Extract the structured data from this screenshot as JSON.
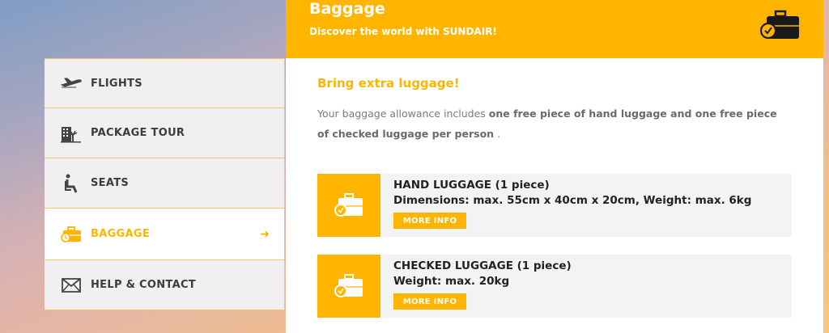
{
  "header": {
    "title": "Baggage",
    "subtitle": "Discover the world with SUNDAIR!",
    "icon": "suitcase-clock-icon",
    "color": "#ffb400"
  },
  "sidebar": {
    "items": [
      {
        "label": "FLIGHTS",
        "icon": "airplane-icon"
      },
      {
        "label": "PACKAGE TOUR",
        "icon": "hotel-palm-icon"
      },
      {
        "label": "SEATS",
        "icon": "seat-icon"
      },
      {
        "label": "BAGGAGE",
        "icon": "suitcase-icon",
        "active": true,
        "arrow": "➜"
      },
      {
        "label": "HELP & CONTACT",
        "icon": "envelope-icon"
      }
    ]
  },
  "content": {
    "title": "Bring extra luggage!",
    "text_prefix": "Your baggage allowance includes ",
    "text_bold": "one free piece of hand luggage and one free piece of checked luggage per person",
    "text_suffix": " ."
  },
  "luggage": [
    {
      "name": "HAND LUGGAGE (1 piece)",
      "detail": "Dimensions: max. 55cm x 40cm x 20cm, Weight: max. 6kg",
      "button": "MORE INFO"
    },
    {
      "name": "CHECKED LUGGAGE (1 piece)",
      "detail": "Weight: max. 20kg",
      "button": "MORE INFO"
    }
  ]
}
